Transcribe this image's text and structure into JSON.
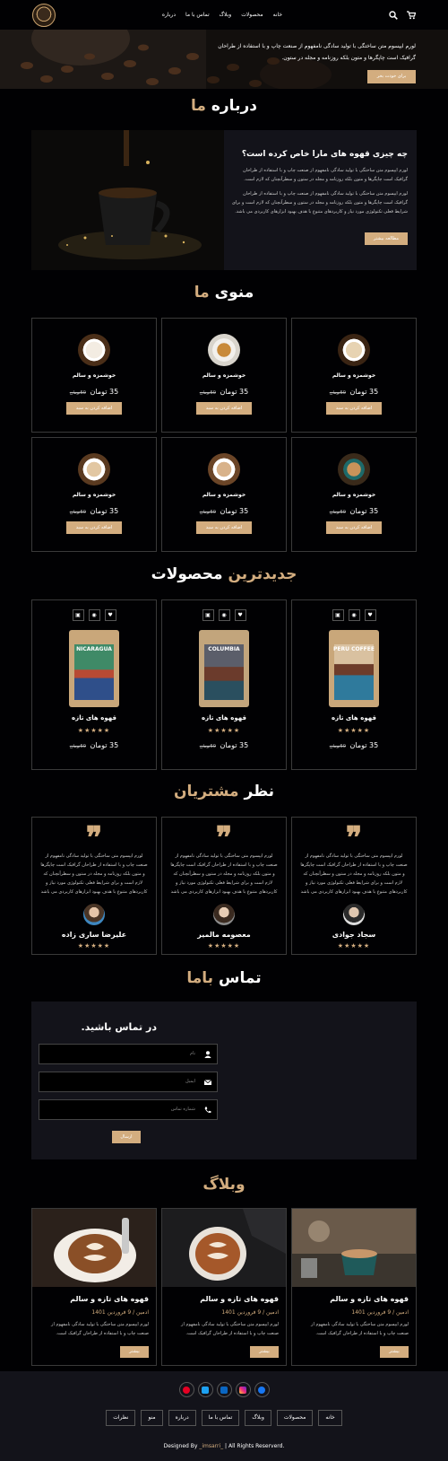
{
  "header": {
    "nav": [
      "خانه",
      "محصولات",
      "وبلاگ",
      "تماس با ما",
      "درباره"
    ]
  },
  "hero": {
    "text": "لورم ایپسوم متن ساختگی با تولید سادگی نامفهوم از صنعت چاپ و با استفاده از طراحان گرافیک است چاپگرها و متون بلکه روزنامه و مجله در ستون.",
    "button": "برای خودت بخر"
  },
  "about": {
    "title": "درباره",
    "title_accent": "ما",
    "heading": "چه چیزی قهوه های مارا خاص کرده است؟",
    "p1": "لورم ایپسوم متن ساختگی با تولید سادگی نامفهوم از صنعت چاپ و با استفاده از طراحان گرافیک است چاپگرها و متون بلکه روزنامه و مجله در ستون و سطرآنچنان که لازم است.",
    "p2": "لورم ایپسوم متن ساختگی با تولید سادگی نامفهوم از صنعت چاپ و با استفاده از طراحان گرافیک است چاپگرها و متون بلکه روزنامه و مجله در ستون و سطرآنچنان که لازم است و برای شرایط فعلی تکنولوژی مورد نیاز و کاربردهای متنوع با هدف بهبود ابزارهای کاربردی می باشد.",
    "button": "مطالعه بیشتر"
  },
  "menu": {
    "title": "منوی",
    "title_accent": "ما",
    "items": [
      {
        "name": "خوشمزه و سالم",
        "price": "35 تومان",
        "old": "50تومان",
        "button": "اضافه کردن به سبد"
      },
      {
        "name": "خوشمزه و سالم",
        "price": "35 تومان",
        "old": "50تومان",
        "button": "اضافه کردن به سبد"
      },
      {
        "name": "خوشمزه و سالم",
        "price": "35 تومان",
        "old": "50تومان",
        "button": "اضافه کردن به سبد"
      },
      {
        "name": "خوشمزه و سالم",
        "price": "35 تومان",
        "old": "50تومان",
        "button": "اضافه کردن به سبد"
      },
      {
        "name": "خوشمزه و سالم",
        "price": "35 تومان",
        "old": "50تومان",
        "button": "اضافه کردن به سبد"
      },
      {
        "name": "خوشمزه و سالم",
        "price": "35 تومان",
        "old": "50تومان",
        "button": "اضافه کردن به سبد"
      }
    ]
  },
  "products": {
    "title_accent": "جدیدترین",
    "title": "محصولات",
    "items": [
      {
        "name": "قهوه های تازه",
        "label": "PERU COFFEE",
        "price": "35 تومان",
        "old": "50تومان",
        "stars": "★★★★★"
      },
      {
        "name": "قهوه های تازه",
        "label": "COLUMBIA",
        "price": "35 تومان",
        "old": "50تومان",
        "stars": "★★★★★"
      },
      {
        "name": "قهوه های تازه",
        "label": "NICARAGUA",
        "price": "35 تومان",
        "old": "50تومان",
        "stars": "★★★★★"
      }
    ]
  },
  "reviews": {
    "title": "نظر",
    "title_accent": "مشتریان",
    "items": [
      {
        "text": "لورم ایپسوم متن ساختگی با تولید سادگی نامفهوم از صنعت چاپ و با استفاده از طراحان گرافیک است چاپگرها و متون بلکه روزنامه و مجله در ستون و سطرآنچنان که لازم است و برای شرایط فعلی تکنولوژی مورد نیاز و کاربردهای متنوع با هدف بهبود ابزارهای کاربردی می باشد",
        "name": "سجاد جوادی",
        "stars": "★★★★★"
      },
      {
        "text": "لورم ایپسوم متن ساختگی با تولید سادگی نامفهوم از صنعت چاپ و با استفاده از طراحان گرافیک است چاپگرها و متون بلکه روزنامه و مجله در ستون و سطرآنچنان که لازم است و برای شرایط فعلی تکنولوژی مورد نیاز و کاربردهای متنوع با هدف بهبود ابزارهای کاربردی می باشد",
        "name": "معصومه مالمیر",
        "stars": "★★★★★"
      },
      {
        "text": "لورم ایپسوم متن ساختگی با تولید سادگی نامفهوم از صنعت چاپ و با استفاده از طراحان گرافیک است چاپگرها و متون بلکه روزنامه و مجله در ستون و سطرآنچنان که لازم است و برای شرایط فعلی تکنولوژی مورد نیاز و کاربردهای متنوع با هدف بهبود ابزارهای کاربردی می باشد",
        "name": "علیرضا ساری زاده",
        "stars": "★★★★★"
      }
    ]
  },
  "contact": {
    "title": "تماس",
    "title_accent": "باما",
    "heading": "در تماس باشید.",
    "name_ph": "نام",
    "email_ph": "ایمیل",
    "phone_ph": "شماره تماس",
    "button": "ارسال"
  },
  "blog": {
    "title": "وبلاگ",
    "items": [
      {
        "title": "قهوه های تازه و سالم",
        "date": "ادمین / 9 فروردین 1401",
        "text": "لورم ایپسوم متن ساختگی با تولید سادگی نامفهوم از صنعت چاپ و با استفاده از طراحان گرافیک است.",
        "button": "بیشتر"
      },
      {
        "title": "قهوه های تازه و سالم",
        "date": "ادمین / 9 فروردین 1401",
        "text": "لورم ایپسوم متن ساختگی با تولید سادگی نامفهوم از صنعت چاپ و با استفاده از طراحان گرافیک است.",
        "button": "بیشتر"
      },
      {
        "title": "قهوه های تازه و سالم",
        "date": "ادمین / 9 فروردین 1401",
        "text": "لورم ایپسوم متن ساختگی با تولید سادگی نامفهوم از صنعت چاپ و با استفاده از طراحان گرافیک است.",
        "button": "بیشتر"
      }
    ]
  },
  "footer": {
    "links": [
      "خانه",
      "محصولات",
      "وبلاگ",
      "تماس با ما",
      "درباره",
      "منو",
      "نظرات"
    ],
    "copy_prefix": "Designed By ",
    "copy_brand": "_imsarri_",
    "copy_suffix": " | All Rights Reserverd."
  },
  "colors": {
    "accent": "#d3ad7f",
    "bg": "#010103",
    "panel": "#13131a"
  }
}
